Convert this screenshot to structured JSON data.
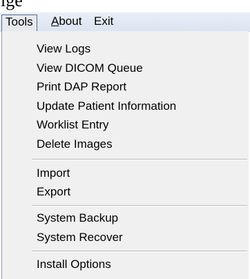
{
  "header_fragment": "ige",
  "menubar": {
    "tools": "Tools",
    "about_mnemonic": "A",
    "about_rest": "bout",
    "exit": "Exit"
  },
  "dropdown": {
    "items": [
      "View Logs",
      "View DICOM Queue",
      "Print DAP Report",
      "Update Patient Information",
      "Worklist Entry",
      "Delete Images",
      "Import",
      "Export",
      "System Backup",
      "System Recover",
      "Install Options"
    ]
  }
}
